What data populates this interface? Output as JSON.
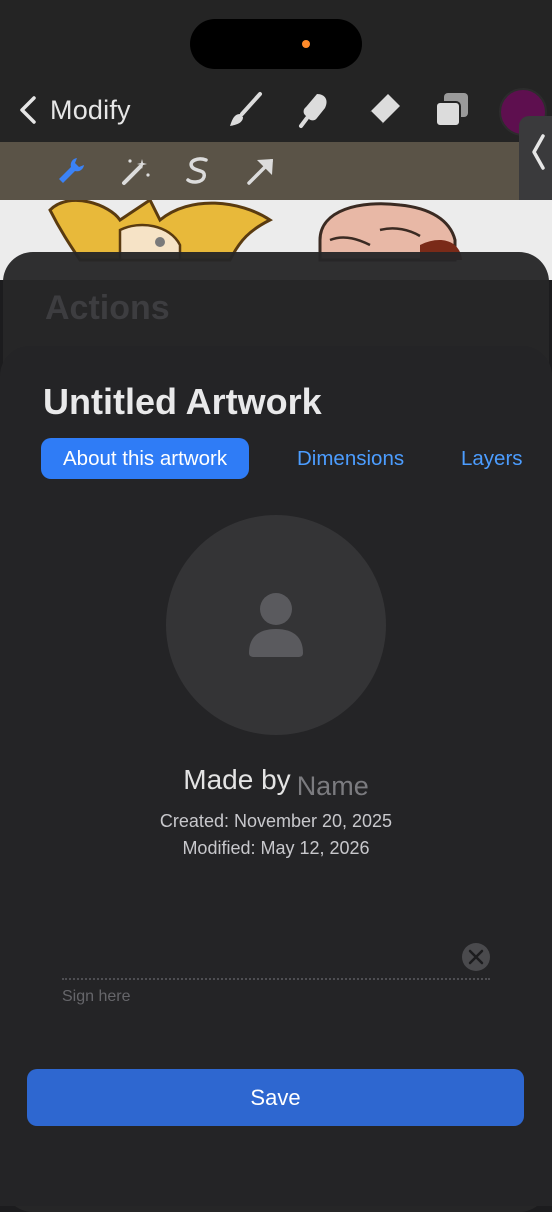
{
  "toolbar": {
    "back_label": "Modify",
    "brush_color": "#5e0f4f"
  },
  "icons": [
    "chevron-left-icon",
    "brush-icon",
    "smudge-icon",
    "eraser-icon",
    "layers-icon",
    "wrench-icon",
    "magic-wand-icon",
    "selection-icon",
    "transform-arrow-icon",
    "chevron-left-handle-icon",
    "person-icon",
    "close-icon"
  ],
  "background_sheet": {
    "title": "Actions"
  },
  "sheet": {
    "title": "Untitled Artwork",
    "tabs": [
      {
        "label": "About this artwork",
        "active": true
      },
      {
        "label": "Dimensions",
        "active": false
      },
      {
        "label": "Layers",
        "active": false
      }
    ],
    "made_by_label": "Made by",
    "name_placeholder": "Name",
    "created": "Created: November 20, 2025",
    "modified": "Modified: May 12, 2026",
    "signature_hint": "Sign here",
    "save_label": "Save"
  },
  "colors": {
    "accent": "#2f7cf6",
    "save_button": "#2e67d0",
    "tab_link": "#4c9dff"
  }
}
